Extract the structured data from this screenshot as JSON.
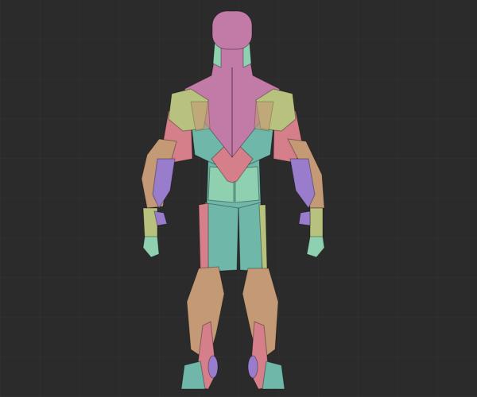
{
  "scene": {
    "background": "#2b2b2b",
    "colors": {
      "pink": "#c27aa6",
      "lime": "#b8c27e",
      "teal": "#6fb7a8",
      "tan": "#c49a76",
      "salmon": "#d47f8a",
      "purple": "#9a7ccc",
      "mint": "#8fd0b0"
    }
  }
}
